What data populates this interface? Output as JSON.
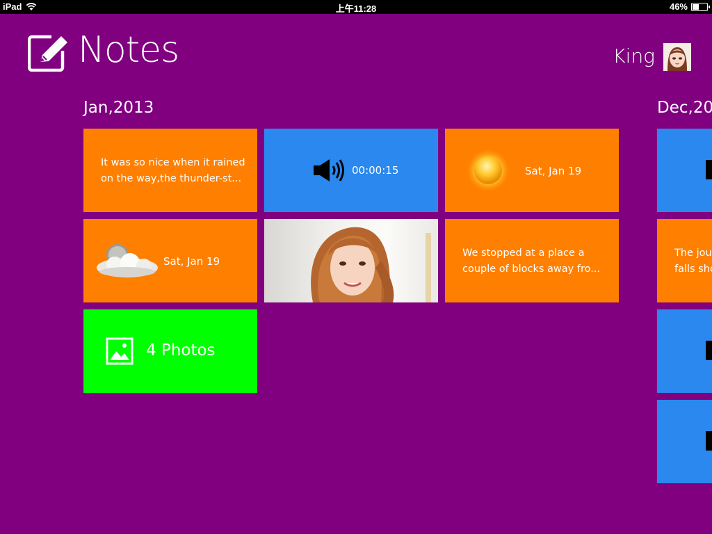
{
  "status_bar": {
    "device": "iPad",
    "time": "上午11:28",
    "battery": "46%",
    "battery_level": 0.46
  },
  "header": {
    "title": "Notes",
    "user": "King"
  },
  "groups": [
    {
      "title": "Jan,2013",
      "tiles": [
        {
          "kind": "text",
          "color": "#ff7f00",
          "lines": [
            "It was so nice when it rained",
            "on the way,the thunder-st..."
          ]
        },
        {
          "kind": "audio",
          "color": "#2a88ee",
          "duration": "00:00:15",
          "icon": "speaker-icon"
        },
        {
          "kind": "weather",
          "color": "#ff7f00",
          "icon": "sun-icon",
          "date": "Sat, Jan 19"
        },
        {
          "kind": "weather",
          "color": "#ff7f00",
          "icon": "cloud-icon",
          "date": "Sat, Jan 19"
        },
        {
          "kind": "photo",
          "icon": "portrait-photo"
        },
        {
          "kind": "text",
          "color": "#ff7f00",
          "lines": [
            "We stopped at a place a",
            "couple of blocks away fro..."
          ]
        },
        {
          "kind": "photos",
          "color": "#00ff00",
          "label": "4 Photos",
          "icon": "image-icon"
        }
      ]
    },
    {
      "title": "Dec,20",
      "tiles": [
        {
          "kind": "audio",
          "color": "#2a88ee"
        },
        {
          "kind": "text",
          "color": "#ff7f00",
          "lines": [
            "The jour",
            "falls sho"
          ]
        },
        {
          "kind": "audio",
          "color": "#2a88ee"
        },
        {
          "kind": "audio",
          "color": "#2a88ee"
        }
      ]
    }
  ]
}
